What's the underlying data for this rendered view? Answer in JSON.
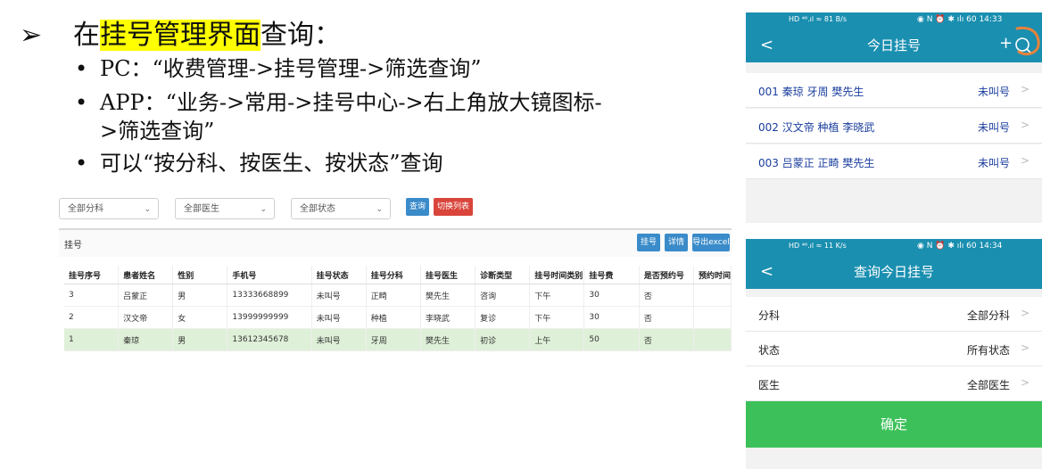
{
  "slide": {
    "arrow": "➢",
    "heading_pre": "在",
    "heading_highlight": "挂号管理界面",
    "heading_post": "查询：",
    "bullets": [
      "PC：“收费管理->挂号管理->筛选查询”",
      "APP：“业务->常用->挂号中心->右上角放大镜图标-",
      ">筛选查询”",
      "可以“按分科、按医生、按状态”查询"
    ],
    "bullet_dot": "•"
  },
  "pc": {
    "filters": [
      "全部分科",
      "全部医生",
      "全部状态"
    ],
    "chevron": "⌄",
    "query_button": "查询",
    "switch_button": "切换列表",
    "toolbar_title": "挂号",
    "toolbar_buttons": [
      "挂号",
      "详情",
      "导出excel"
    ],
    "columns": [
      "挂号序号",
      "患者姓名",
      "性别",
      "手机号",
      "挂号状态",
      "挂号分科",
      "挂号医生",
      "诊断类型",
      "挂号时间类别",
      "挂号费",
      "是否预约号",
      "预约时间"
    ],
    "rows": [
      [
        "3",
        "吕蒙正",
        "男",
        "13333668899",
        "未叫号",
        "正畸",
        "樊先生",
        "咨询",
        "下午",
        "30",
        "否",
        ""
      ],
      [
        "2",
        "汉文帝",
        "女",
        "13999999999",
        "未叫号",
        "种植",
        "李晓武",
        "复诊",
        "下午",
        "30",
        "否",
        ""
      ],
      [
        "1",
        "秦琼",
        "男",
        "13612345678",
        "未叫号",
        "牙周",
        "樊先生",
        "初诊",
        "上午",
        "50",
        "否",
        ""
      ]
    ],
    "selected_row": 2
  },
  "phone1": {
    "status_left": "HD ⁴⁶.ıl ≈ 81 B/s",
    "status_right": "◉ N ⏰ ✱ ılı 60 14:33",
    "title": "今日挂号",
    "back": "<",
    "plus": "+",
    "list": [
      {
        "left": "001 秦琼   牙周 樊先生",
        "right": "未叫号"
      },
      {
        "left": "002 汉文帝   种植 李晓武",
        "right": "未叫号"
      },
      {
        "left": "003 吕蒙正   正畸 樊先生",
        "right": "未叫号"
      }
    ],
    "gt": ">"
  },
  "phone2": {
    "status_left": "HD ⁴⁶.ıl ≈ 11 K/s",
    "status_right": "◉ N ⏰ ✱ ılı 60 14:34",
    "title": "查询今日挂号",
    "back": "<",
    "rows": [
      {
        "label": "分科",
        "value": "全部分科"
      },
      {
        "label": "状态",
        "value": "所有状态"
      },
      {
        "label": "医生",
        "value": "全部医生"
      }
    ],
    "confirm": "确定"
  },
  "colors": {
    "highlight": "#ffff00",
    "phone_bar": "#1a8fb0",
    "confirm": "#3cc15a",
    "btn_blue": "#3a8bc9",
    "btn_red": "#d9453b",
    "annotation": "#e8823a"
  }
}
